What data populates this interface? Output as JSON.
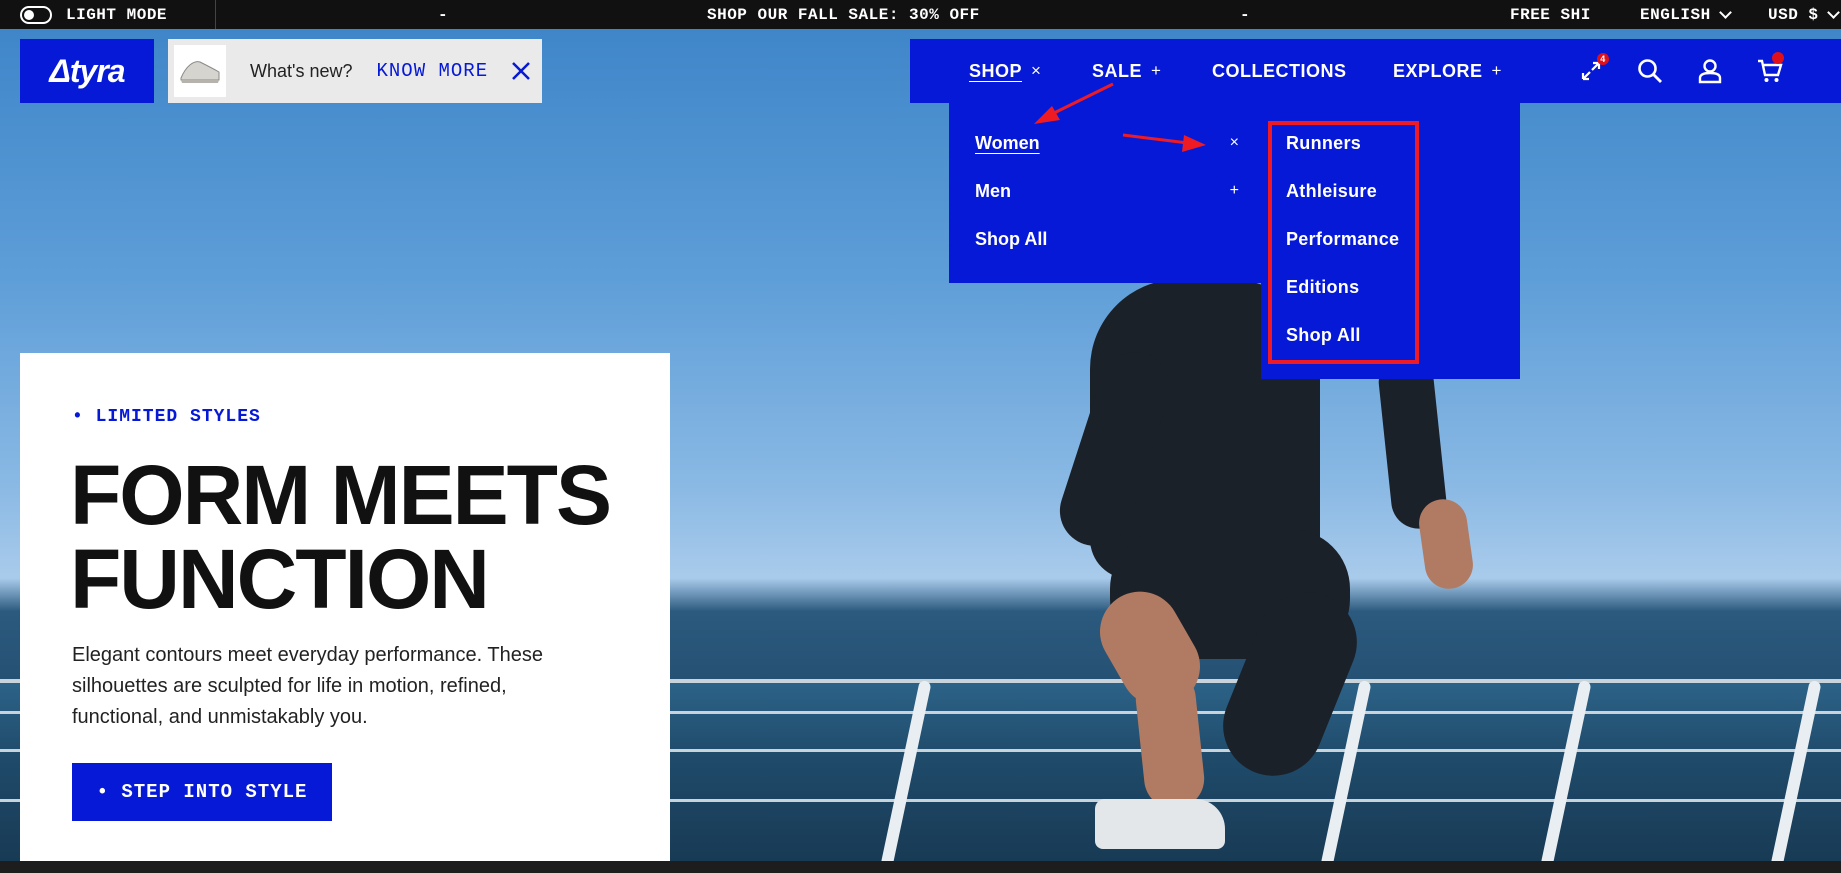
{
  "topbar": {
    "mode_label": "LIGHT MODE",
    "sep1": "-",
    "announcement": "SHOP OUR FALL SALE: 30% OFF",
    "sep2": "-",
    "announcement_2": "FREE SHI",
    "language": "ENGLISH",
    "currency": "USD $"
  },
  "header": {
    "logo": "Δtyra",
    "promo": {
      "text": "What's new?",
      "link": "KNOW MORE"
    }
  },
  "nav": {
    "items": [
      {
        "label": "SHOP",
        "mark": "×"
      },
      {
        "label": "SALE",
        "mark": "+"
      },
      {
        "label": "COLLECTIONS",
        "mark": ""
      },
      {
        "label": "EXPLORE",
        "mark": "+"
      }
    ],
    "compare_count": "4"
  },
  "dropdown": {
    "level1": [
      {
        "label": "Women",
        "mark": "×"
      },
      {
        "label": "Men",
        "mark": "+"
      },
      {
        "label": "Shop All",
        "mark": ""
      }
    ],
    "level2": [
      "Runners",
      "Athleisure",
      "Performance",
      "Editions",
      "Shop All"
    ]
  },
  "hero": {
    "eyebrow": "• LIMITED STYLES",
    "headline_line1": "FORM MEETS",
    "headline_line2": "FUNCTION",
    "body": "Elegant contours meet everyday performance. These silhouettes are sculpted for life in motion, refined, functional, and unmistakably you.",
    "cta": "• STEP INTO STYLE"
  },
  "colors": {
    "brand_blue": "#0619d6",
    "annotation_red": "#ee1b24"
  }
}
